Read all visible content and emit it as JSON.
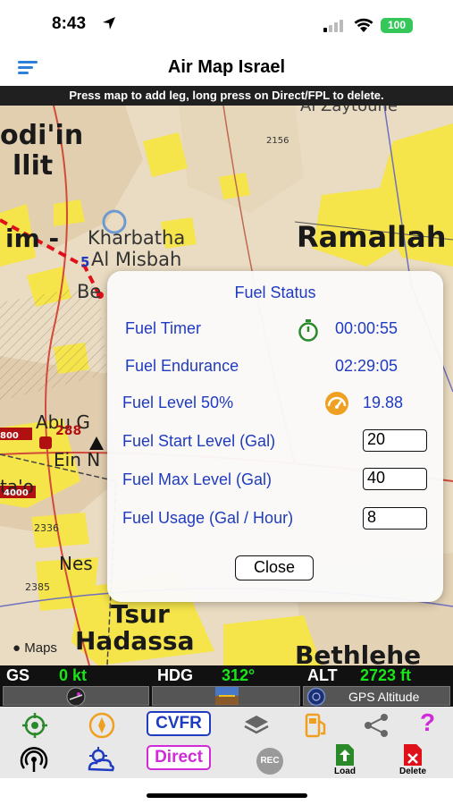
{
  "status_bar": {
    "time": "8:43",
    "battery": "100"
  },
  "nav": {
    "title": "Air Map Israel"
  },
  "hint": "Press map to add leg, long press on Direct/FPL to delete.",
  "map": {
    "labels": {
      "odi_in": "odi'in",
      "llit": "llit",
      "im": "im -",
      "kharbatha": "Kharbatha",
      "al_misbah": "Al Misbah",
      "be": "Be",
      "ramallah": "Ramallah",
      "al_zaytoune": "Al Zaytoune",
      "abu": "Abu G",
      "ein_n": "Ein N",
      "ta_o": "ta'o",
      "nes": "Nes",
      "tsur": "Tsur",
      "hadassa": "Hadassa",
      "bethlehem": "Bethlehe",
      "elev_2156": "2156",
      "elev_2336": "2336",
      "elev_2385": "2385",
      "elev_4000": "4000",
      "elev_800": "800",
      "elev_288": "288",
      "leg_number": "5"
    },
    "maps_logo": "Maps",
    "colors": {
      "terrain": "#e9dcc4",
      "urban": "#f5e44a",
      "route": "#e0101a",
      "road": "#d24a3a"
    }
  },
  "fuel_dialog": {
    "title": "Fuel Status",
    "timer_label": "Fuel Timer",
    "timer_value": "00:00:55",
    "endurance_label": "Fuel Endurance",
    "endurance_value": "02:29:05",
    "level_label": "Fuel Level 50%",
    "level_value": "19.88",
    "start_label": "Fuel Start Level (Gal)",
    "start_value": "20",
    "max_label": "Fuel Max Level (Gal)",
    "max_value": "40",
    "usage_label": "Fuel Usage (Gal / Hour)",
    "usage_value": "8",
    "close_label": "Close",
    "icons": {
      "timer": "stopwatch-icon",
      "level": "fuel-gauge-icon"
    }
  },
  "telemetry": {
    "gs_label": "GS",
    "gs_value": "0 kt",
    "hdg_label": "HDG",
    "hdg_value": "312°",
    "alt_label": "ALT",
    "alt_value": "2723 ft",
    "gps_altitude_label": "GPS Altitude"
  },
  "toolbar": {
    "cvfr_label": "CVFR",
    "direct_label": "Direct",
    "rec_label": "REC",
    "load_label": "Load",
    "delete_label": "Delete",
    "help_label": "?",
    "icons": [
      "crosshair-icon",
      "compass-icon",
      "layers-icon",
      "fuel-station-icon",
      "share-icon",
      "help-icon",
      "radar-icon",
      "weather-icon",
      "rec-icon",
      "load-icon",
      "delete-icon"
    ]
  },
  "accent_colors": {
    "dialog_text": "#1f3bbf",
    "telemetry_value": "#19e619",
    "cvfr": "#1f3bbf",
    "direct": "#d12ad8",
    "icon_orange": "#f0a020",
    "icon_green": "#2a8a2a",
    "help": "#d12ad8"
  }
}
